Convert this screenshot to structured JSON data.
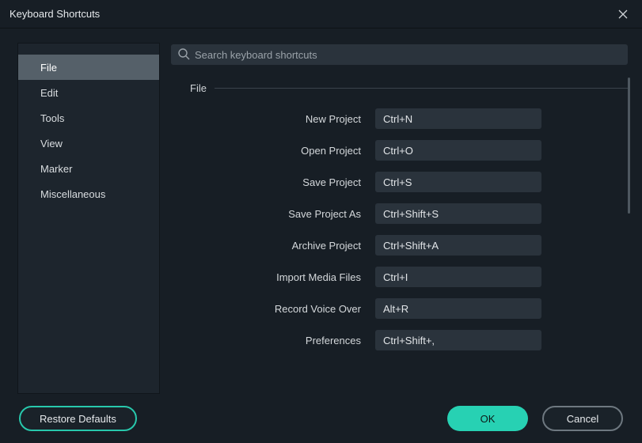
{
  "titlebar": {
    "title": "Keyboard Shortcuts"
  },
  "sidebar": {
    "items": [
      {
        "label": "File",
        "active": true
      },
      {
        "label": "Edit",
        "active": false
      },
      {
        "label": "Tools",
        "active": false
      },
      {
        "label": "View",
        "active": false
      },
      {
        "label": "Marker",
        "active": false
      },
      {
        "label": "Miscellaneous",
        "active": false
      }
    ]
  },
  "search": {
    "placeholder": "Search keyboard shortcuts"
  },
  "section": {
    "title": "File"
  },
  "shortcuts": [
    {
      "label": "New Project",
      "keys": "Ctrl+N"
    },
    {
      "label": "Open Project",
      "keys": "Ctrl+O"
    },
    {
      "label": "Save Project",
      "keys": "Ctrl+S"
    },
    {
      "label": "Save Project As",
      "keys": "Ctrl+Shift+S"
    },
    {
      "label": "Archive Project",
      "keys": "Ctrl+Shift+A"
    },
    {
      "label": "Import Media Files",
      "keys": "Ctrl+I"
    },
    {
      "label": "Record Voice Over",
      "keys": "Alt+R"
    },
    {
      "label": "Preferences",
      "keys": "Ctrl+Shift+,"
    }
  ],
  "footer": {
    "restore": "Restore Defaults",
    "ok": "OK",
    "cancel": "Cancel"
  },
  "colors": {
    "accent": "#27d1b3"
  }
}
